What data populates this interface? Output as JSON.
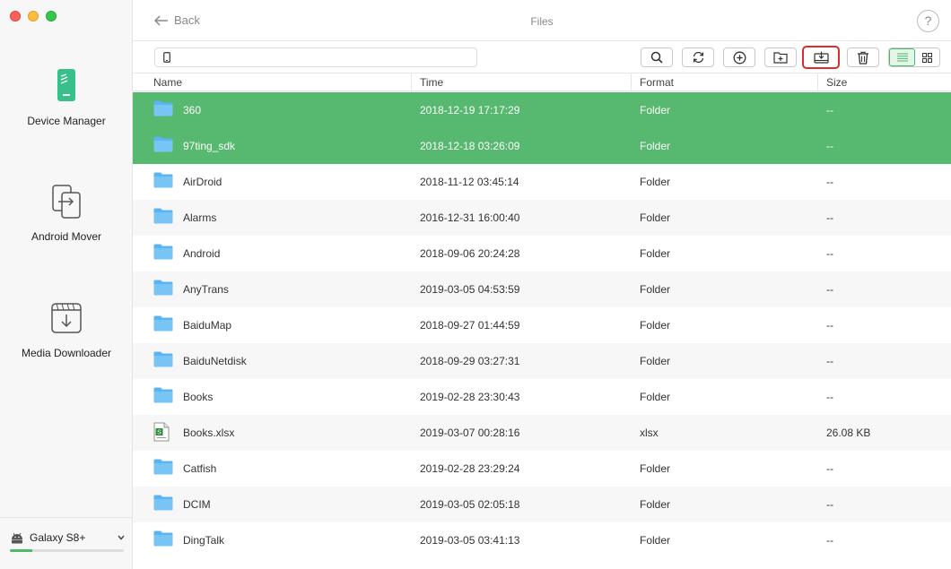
{
  "sidebar": {
    "nav": [
      {
        "label": "Device Manager",
        "icon": "phone-manager-icon"
      },
      {
        "label": "Android Mover",
        "icon": "transfer-icon"
      },
      {
        "label": "Media Downloader",
        "icon": "download-icon"
      }
    ],
    "device": {
      "name": "Galaxy S8+",
      "icon": "android-icon",
      "storage_used_fraction": 0.2
    }
  },
  "header": {
    "back_label": "Back",
    "title": "Files",
    "help_label": "?"
  },
  "toolbar": {
    "buttons": [
      "search-icon",
      "refresh-icon",
      "add-icon",
      "new-folder-icon",
      "export-to-computer-icon",
      "delete-icon"
    ],
    "view_modes": [
      "list-view-icon",
      "grid-view-icon"
    ],
    "active_view": "list"
  },
  "table": {
    "columns": [
      "Name",
      "Time",
      "Format",
      "Size"
    ],
    "rows": [
      {
        "name": "360",
        "time": "2018-12-19 17:17:29",
        "format": "Folder",
        "size": "--",
        "type": "folder",
        "selected": true
      },
      {
        "name": "97ting_sdk",
        "time": "2018-12-18 03:26:09",
        "format": "Folder",
        "size": "--",
        "type": "folder",
        "selected": true
      },
      {
        "name": "AirDroid",
        "time": "2018-11-12 03:45:14",
        "format": "Folder",
        "size": "--",
        "type": "folder",
        "selected": false
      },
      {
        "name": "Alarms",
        "time": "2016-12-31 16:00:40",
        "format": "Folder",
        "size": "--",
        "type": "folder",
        "selected": false
      },
      {
        "name": "Android",
        "time": "2018-09-06 20:24:28",
        "format": "Folder",
        "size": "--",
        "type": "folder",
        "selected": false
      },
      {
        "name": "AnyTrans",
        "time": "2019-03-05 04:53:59",
        "format": "Folder",
        "size": "--",
        "type": "folder",
        "selected": false
      },
      {
        "name": "BaiduMap",
        "time": "2018-09-27 01:44:59",
        "format": "Folder",
        "size": "--",
        "type": "folder",
        "selected": false
      },
      {
        "name": "BaiduNetdisk",
        "time": "2018-09-29 03:27:31",
        "format": "Folder",
        "size": "--",
        "type": "folder",
        "selected": false
      },
      {
        "name": "Books",
        "time": "2019-02-28 23:30:43",
        "format": "Folder",
        "size": "--",
        "type": "folder",
        "selected": false
      },
      {
        "name": "Books.xlsx",
        "time": "2019-03-07 00:28:16",
        "format": "xlsx",
        "size": "26.08 KB",
        "type": "xlsx",
        "selected": false
      },
      {
        "name": "Catfish",
        "time": "2019-02-28 23:29:24",
        "format": "Folder",
        "size": "--",
        "type": "folder",
        "selected": false
      },
      {
        "name": "DCIM",
        "time": "2019-03-05 02:05:18",
        "format": "Folder",
        "size": "--",
        "type": "folder",
        "selected": false
      },
      {
        "name": "DingTalk",
        "time": "2019-03-05 03:41:13",
        "format": "Folder",
        "size": "--",
        "type": "folder",
        "selected": false
      }
    ]
  },
  "colors": {
    "accent": "#57b86f",
    "folder": "#5ab4ef",
    "highlight": "#e02b2b"
  }
}
